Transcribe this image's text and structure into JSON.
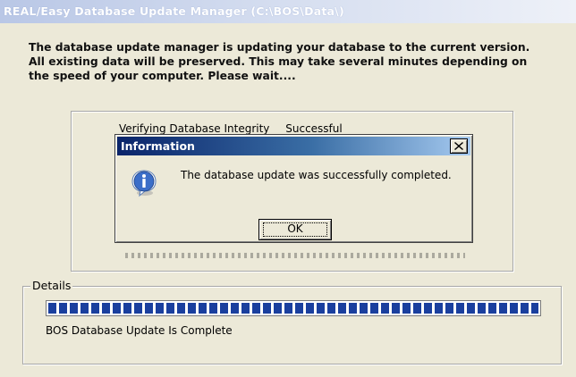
{
  "window": {
    "title": "REAL/Easy Database Update Manager (C:\\BOS\\Data\\)"
  },
  "intro": {
    "line1": "The database update manager is updating your database to the current version.",
    "line2": "All existing data will be preserved. This may take several minutes depending on",
    "line3": "the speed of your computer. Please wait...."
  },
  "progress_steps": [
    {
      "label": "Verifying Database Integrity",
      "status": "Successful"
    }
  ],
  "details": {
    "legend": "Details",
    "progress_fraction": 1.0,
    "status_text": "BOS Database Update Is Complete"
  },
  "dialog": {
    "title": "Information",
    "message": "The database update was successfully completed.",
    "ok_label": "OK",
    "icon": "information-icon"
  },
  "colors": {
    "progress_fill": "#1a3f9e",
    "dialog_title_start": "#0a246a",
    "dialog_title_end": "#a6caf0"
  }
}
